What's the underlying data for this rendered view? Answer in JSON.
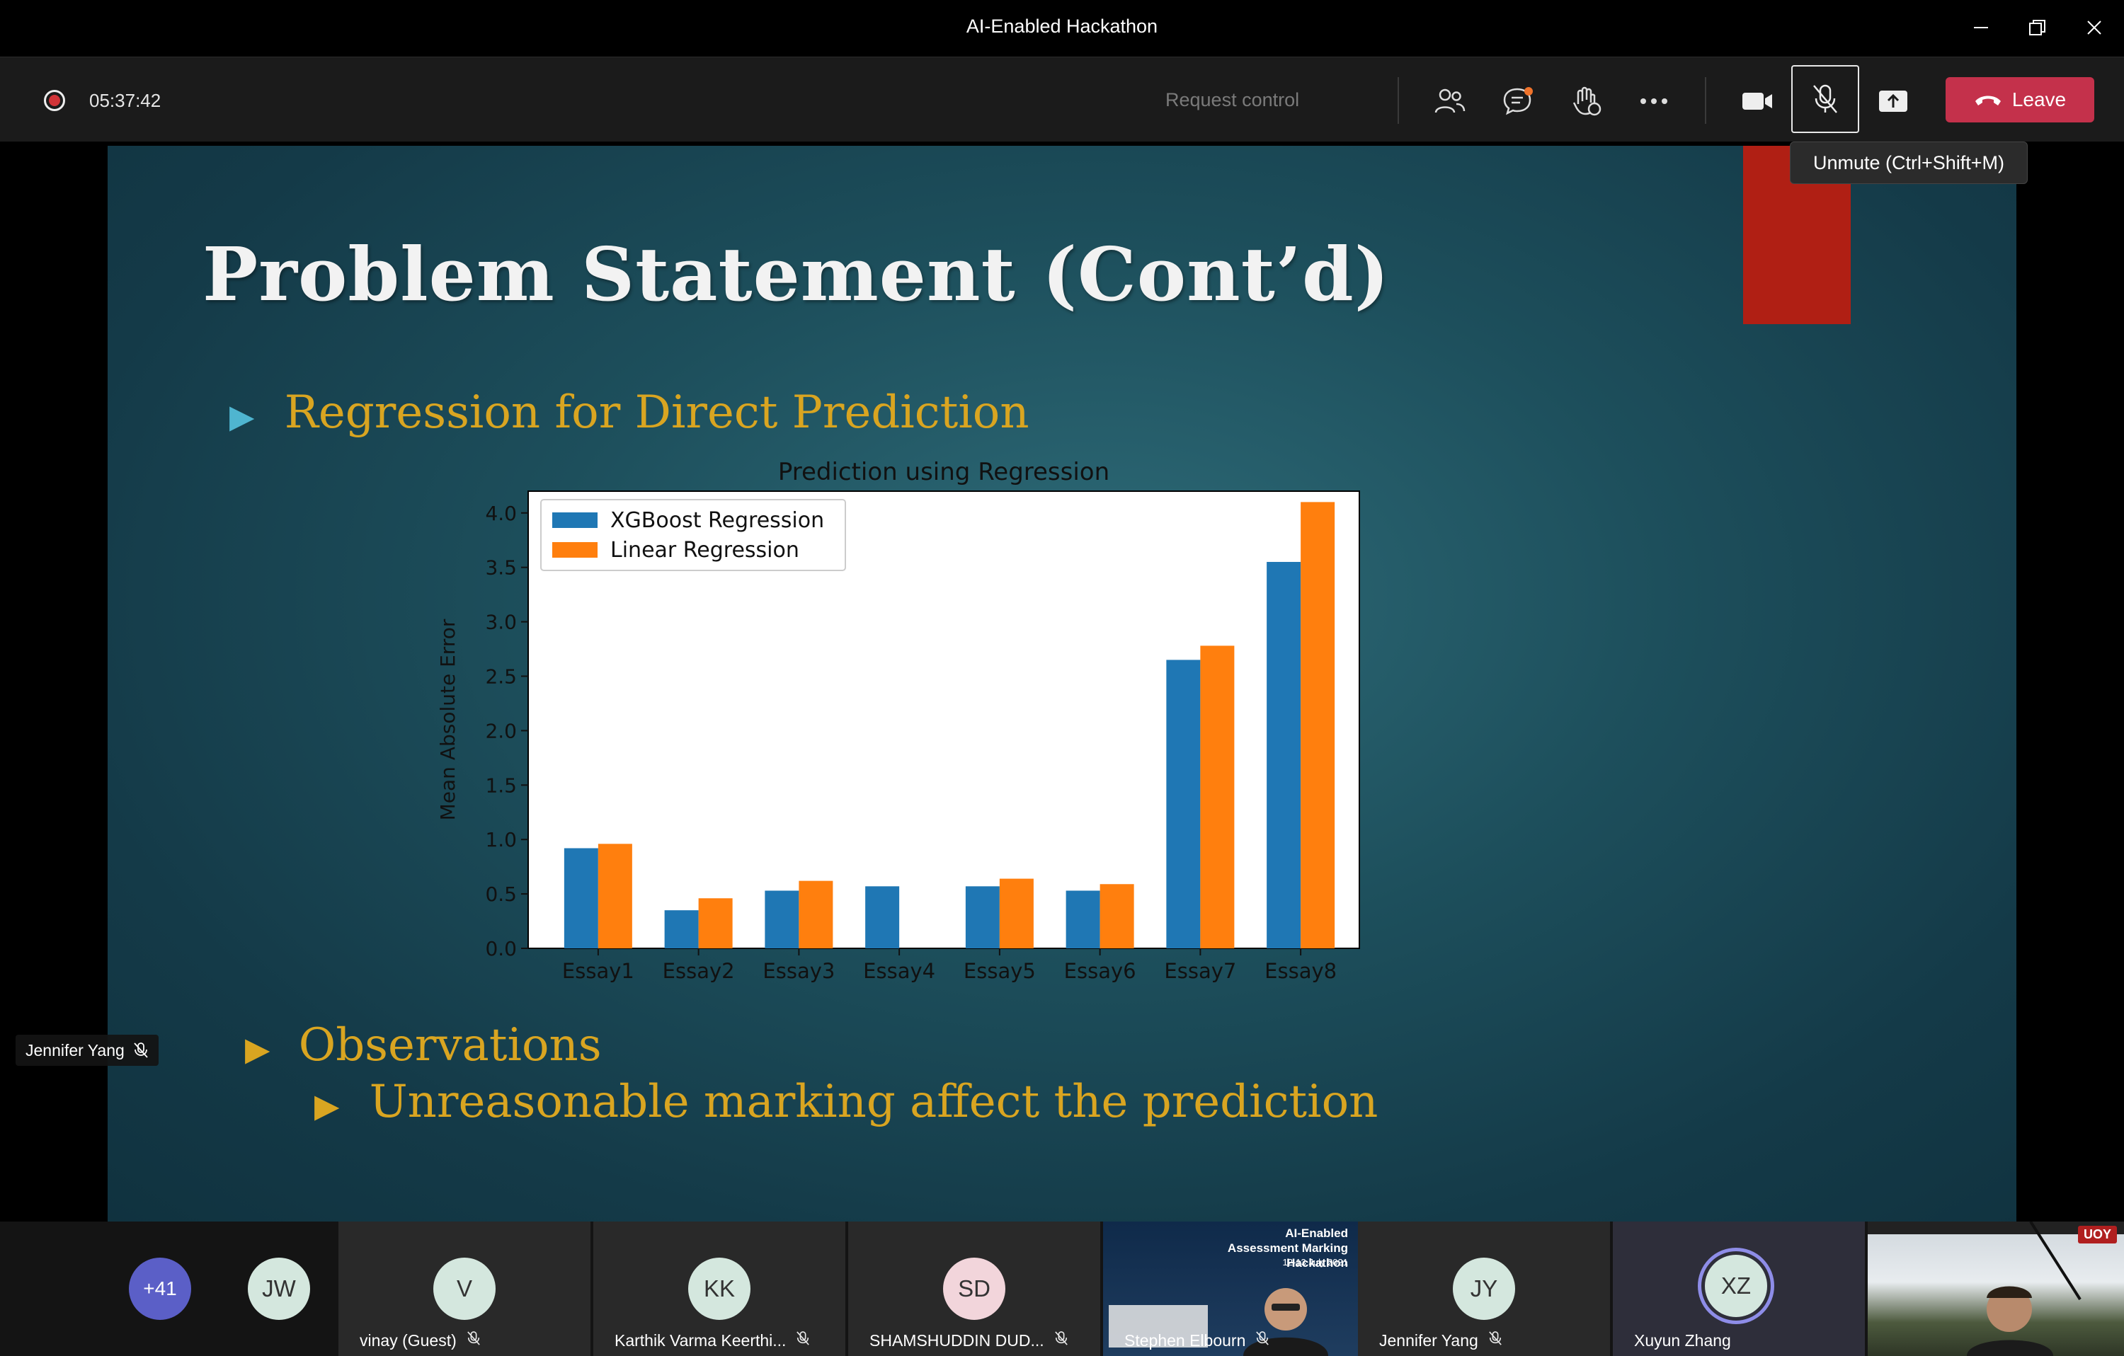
{
  "window": {
    "title": "AI-Enabled Hackathon"
  },
  "toolbar": {
    "timer": "05:37:42",
    "request_control": "Request control",
    "leave_label": "Leave",
    "tooltip": "Unmute (Ctrl+Shift+M)",
    "icons": [
      "people-icon",
      "chat-icon",
      "reactions-icon",
      "more-icon",
      "camera-icon",
      "mic-off-icon",
      "share-icon"
    ],
    "colors": {
      "leave": "#c4314b",
      "record": "#d13438"
    }
  },
  "slide": {
    "title": "Problem Statement (Cont’d)",
    "bullet1": "Regression for Direct Prediction",
    "bullet2": "Observations",
    "bullet3": "Unreasonable marking affect the prediction",
    "colors": {
      "bullet_text": "#d9a521",
      "accent_block": "#b01f14"
    }
  },
  "chart_data": {
    "type": "bar",
    "title": "Prediction using Regression",
    "xlabel": "",
    "ylabel": "Mean Absolute Error",
    "categories": [
      "Essay1",
      "Essay2",
      "Essay3",
      "Essay4",
      "Essay5",
      "Essay6",
      "Essay7",
      "Essay8"
    ],
    "series": [
      {
        "name": "XGBoost Regression",
        "color": "#1f77b4",
        "values": [
          0.92,
          0.35,
          0.53,
          0.57,
          0.57,
          0.53,
          2.65,
          3.55
        ]
      },
      {
        "name": "Linear Regression",
        "color": "#ff7f0e",
        "values": [
          0.96,
          0.46,
          0.62,
          0.0,
          0.64,
          0.59,
          2.78,
          4.1
        ]
      }
    ],
    "ylim": [
      0,
      4.2
    ],
    "yticks": [
      "0.0",
      "0.5",
      "1.0",
      "1.5",
      "2.0",
      "2.5",
      "3.0",
      "3.5",
      "4.0"
    ],
    "legend": "top-left",
    "grid": false
  },
  "presenter": {
    "name": "Jennifer Yang"
  },
  "participants": [
    {
      "initials": "+41",
      "name": ""
    },
    {
      "initials": "JW",
      "name": ""
    },
    {
      "initials": "V",
      "name": "vinay (Guest)"
    },
    {
      "initials": "KK",
      "name": "Karthik Varma Keerthi..."
    },
    {
      "initials": "SD",
      "name": "SHAMSHUDDIN DUD..."
    },
    {
      "initials": "",
      "name": "Stephen Elbourn",
      "poster_title": "AI-Enabled Assessment Marking Hackathon",
      "poster_date": "12-13 July 2021"
    },
    {
      "initials": "JY",
      "name": "Jennifer Yang"
    },
    {
      "initials": "XZ",
      "name": "Xuyun Zhang"
    },
    {
      "initials": "",
      "name": "",
      "badge": "UOY"
    }
  ]
}
